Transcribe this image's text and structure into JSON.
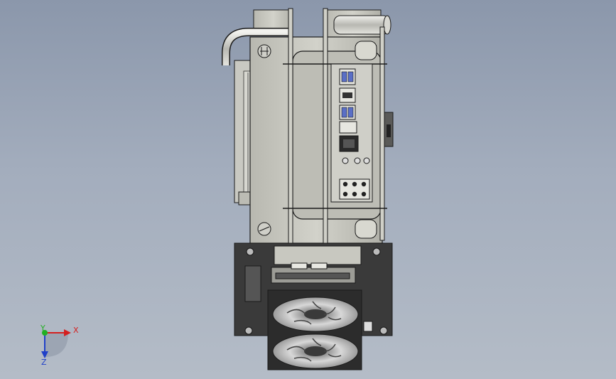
{
  "triad": {
    "x_label": "X",
    "y_label": "Y",
    "z_label": "Z",
    "x_color": "#d42020",
    "y_color": "#22b022",
    "z_color": "#2040c8"
  },
  "colors": {
    "metal": "#c4c4bc",
    "metal_dark": "#8c8c86",
    "edge": "#1a1a1a",
    "gpu_dark": "#333333",
    "port_blue": "#5a6fc6"
  }
}
